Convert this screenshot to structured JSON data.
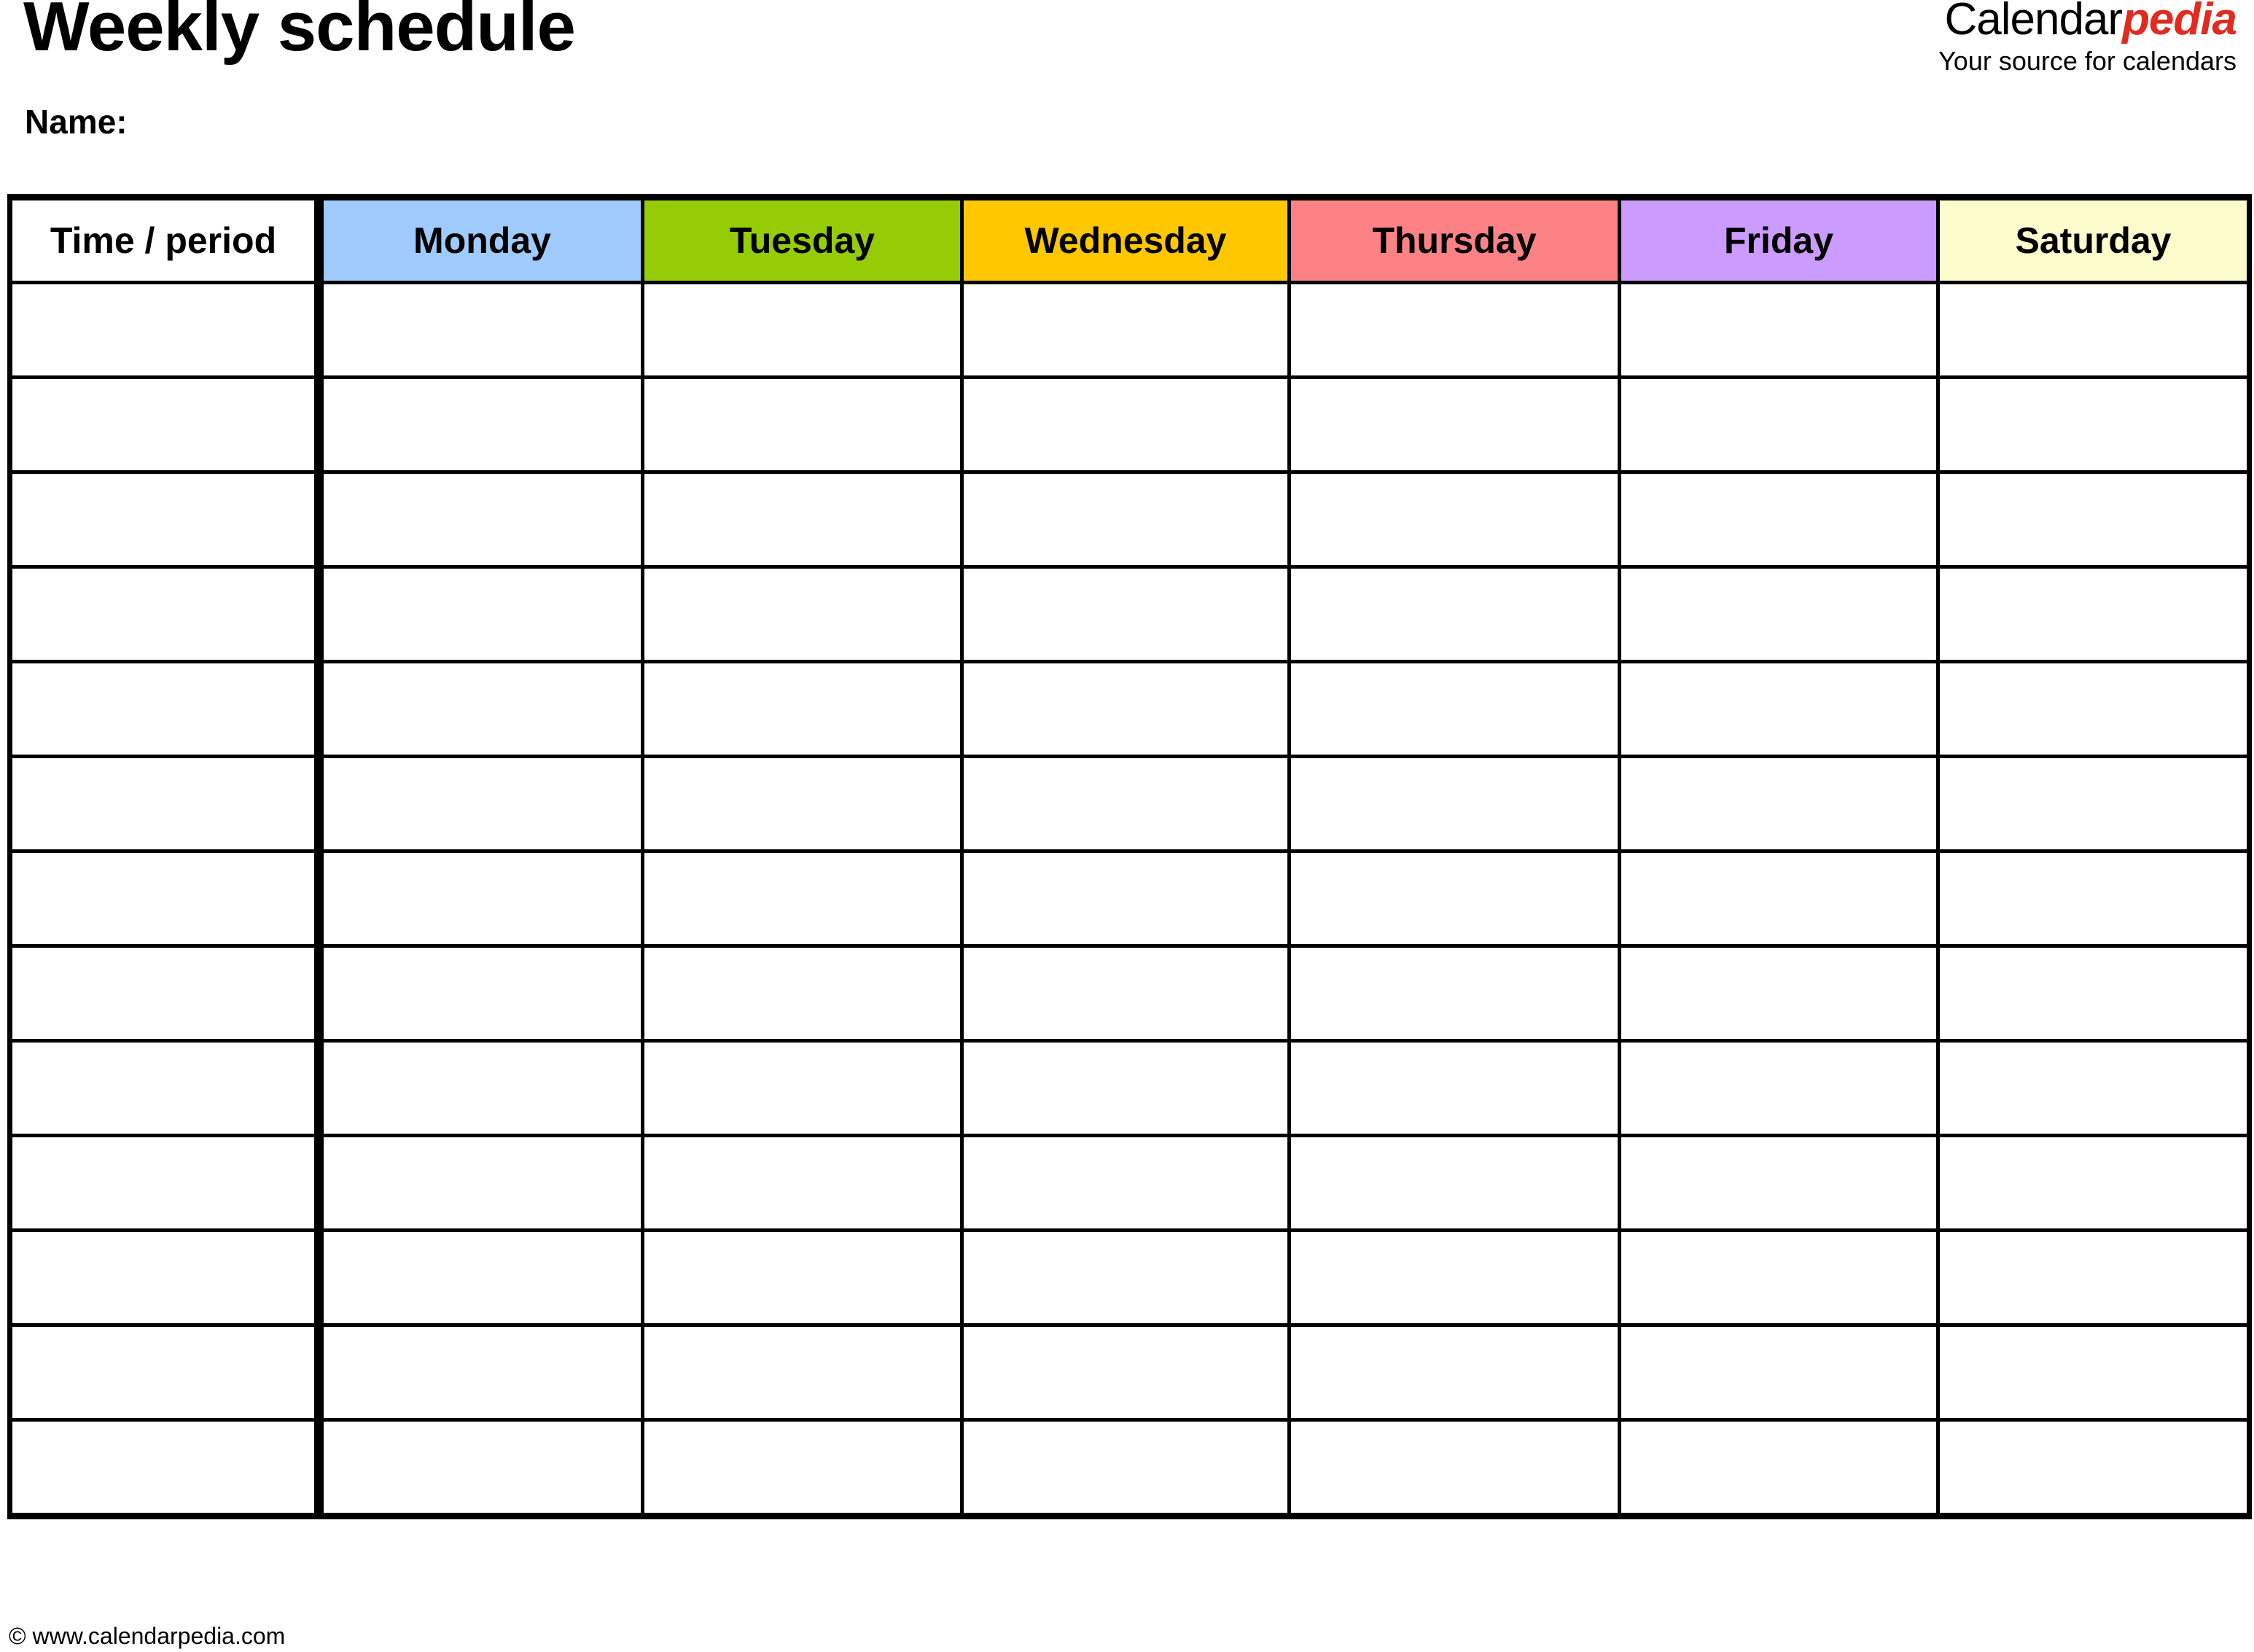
{
  "document": {
    "title": "Weekly schedule",
    "name_label": "Name:"
  },
  "brand": {
    "part_black": "Calendar",
    "part_red": "pedia",
    "tagline": "Your source for calendars",
    "accent_color": "#e02b20"
  },
  "table": {
    "columns": [
      {
        "label": "Time / period",
        "color": "#ffffff",
        "key": "time"
      },
      {
        "label": "Monday",
        "color": "#9ecbfc",
        "key": "mon"
      },
      {
        "label": "Tuesday",
        "color": "#95cc05",
        "key": "tue"
      },
      {
        "label": "Wednesday",
        "color": "#ffc700",
        "key": "wed"
      },
      {
        "label": "Thursday",
        "color": "#fc8285",
        "key": "thu"
      },
      {
        "label": "Friday",
        "color": "#cb9cfd",
        "key": "fri"
      },
      {
        "label": "Saturday",
        "color": "#fcfbcc",
        "key": "sat"
      }
    ],
    "row_count": 13,
    "rows": [
      [
        "",
        "",
        "",
        "",
        "",
        "",
        ""
      ],
      [
        "",
        "",
        "",
        "",
        "",
        "",
        ""
      ],
      [
        "",
        "",
        "",
        "",
        "",
        "",
        ""
      ],
      [
        "",
        "",
        "",
        "",
        "",
        "",
        ""
      ],
      [
        "",
        "",
        "",
        "",
        "",
        "",
        ""
      ],
      [
        "",
        "",
        "",
        "",
        "",
        "",
        ""
      ],
      [
        "",
        "",
        "",
        "",
        "",
        "",
        ""
      ],
      [
        "",
        "",
        "",
        "",
        "",
        "",
        ""
      ],
      [
        "",
        "",
        "",
        "",
        "",
        "",
        ""
      ],
      [
        "",
        "",
        "",
        "",
        "",
        "",
        ""
      ],
      [
        "",
        "",
        "",
        "",
        "",
        "",
        ""
      ],
      [
        "",
        "",
        "",
        "",
        "",
        "",
        ""
      ],
      [
        "",
        "",
        "",
        "",
        "",
        "",
        ""
      ]
    ]
  },
  "footer": {
    "copyright": "© www.calendarpedia.com"
  }
}
